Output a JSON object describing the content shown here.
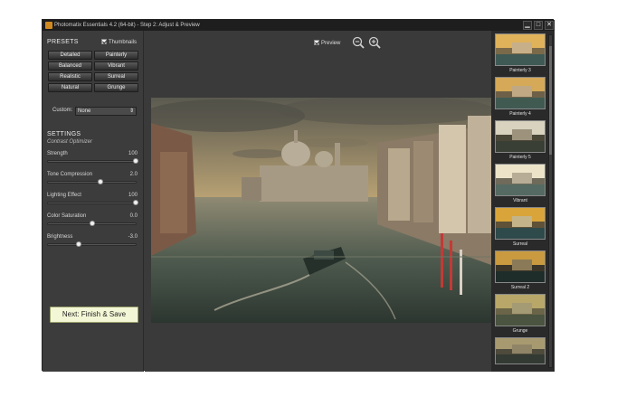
{
  "window": {
    "title": "Photomatix Essentials 4.2 (64-bit) - Step 2: Adjust & Preview",
    "minimize": "▁",
    "maximize": "□",
    "close": "✕"
  },
  "presets": {
    "heading": "PRESETS",
    "thumbnails_label": "Thumbnails",
    "thumbnails_checked": true,
    "buttons": [
      "Detailed",
      "Painterly",
      "Balanced",
      "Vibrant",
      "Realistic",
      "Surreal",
      "Natural",
      "Grunge"
    ],
    "custom_label": "Custom:",
    "custom_value": "None"
  },
  "settings": {
    "heading": "SETTINGS",
    "subheading": "Contrast Optimizer",
    "sliders": [
      {
        "label": "Strength",
        "value": "100",
        "fraction": 1.0
      },
      {
        "label": "Tone Compression",
        "value": "2.0",
        "fraction": 0.6
      },
      {
        "label": "Lighting Effect",
        "value": "100",
        "fraction": 1.0
      },
      {
        "label": "Color Saturation",
        "value": "0.0",
        "fraction": 0.5
      },
      {
        "label": "Brightness",
        "value": "-3.0",
        "fraction": 0.35
      }
    ]
  },
  "actions": {
    "next_label": "Next: Finish & Save"
  },
  "preview": {
    "label": "Preview",
    "checked": true,
    "zoom_out_icon": "zoom-out-icon",
    "zoom_in_icon": "zoom-in-icon"
  },
  "thumbnails": [
    "Painterly 3",
    "Painterly 4",
    "Painterly 5",
    "Vibrant",
    "Surreal",
    "Surreal 2",
    "Grunge"
  ]
}
